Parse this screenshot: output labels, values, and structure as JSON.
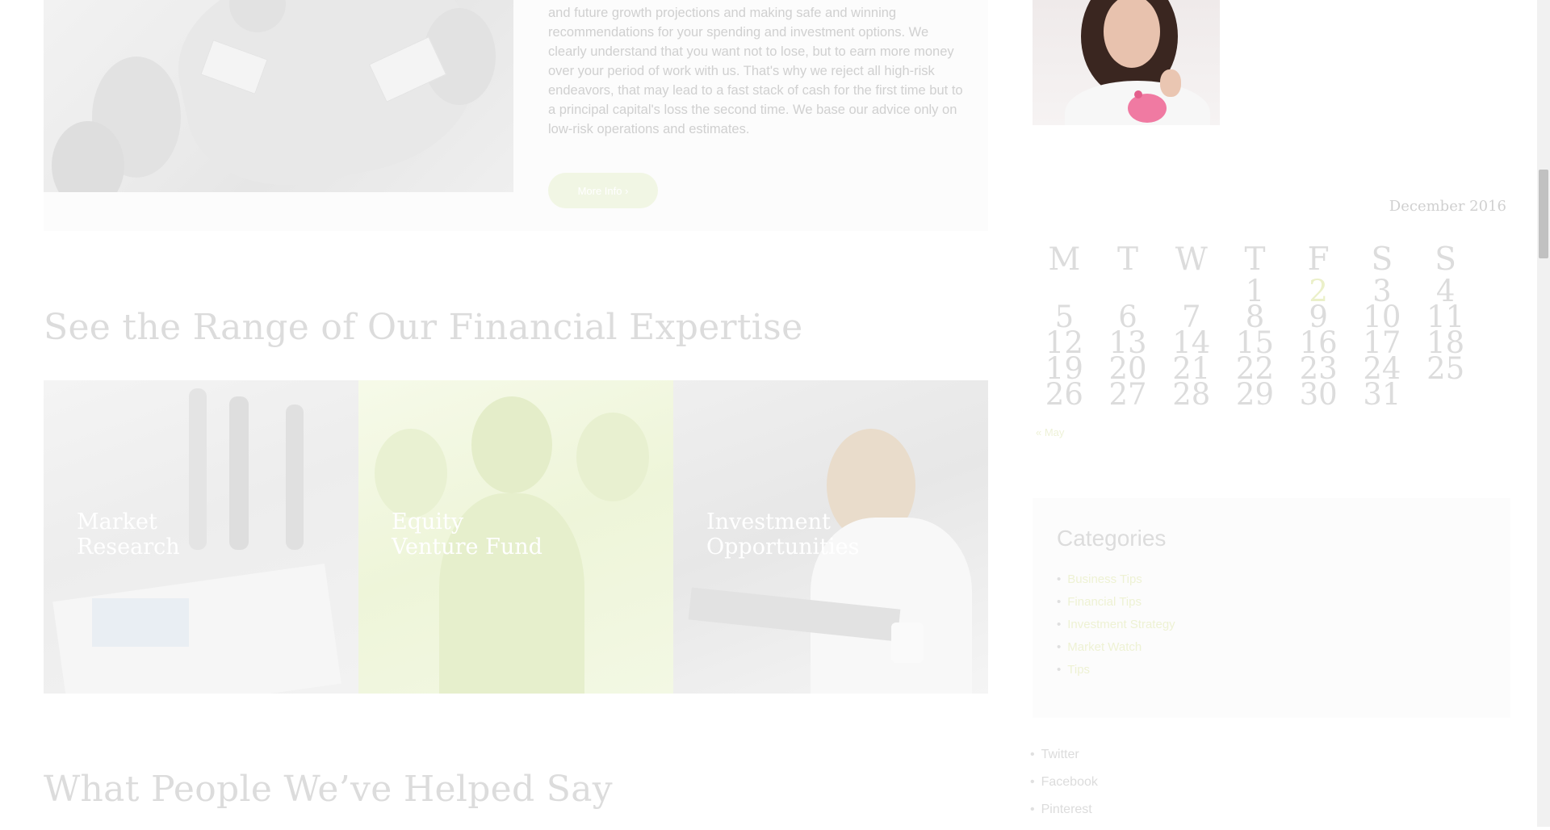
{
  "about": {
    "text": "and future growth projections and making safe and winning recommendations for your spending and investment options. We clearly understand that you want not to lose, but to earn more money over your period of work with us. That's why we reject all high-risk endeavors, that may lead to a fast stack of cash for the first time but to a principal capital's loss the second time. We base our advice only on low-risk operations and estimates.",
    "button_label": "More Info  ›"
  },
  "expertise": {
    "title": "See the Range of Our Financial Expertise",
    "services": [
      {
        "line1": "Market",
        "line2": "Research"
      },
      {
        "line1": "Equity",
        "line2": "Venture Fund"
      },
      {
        "line1": "Investment",
        "line2": "Opportunities"
      }
    ]
  },
  "testimonials": {
    "title": "What People We’ve Helped Say"
  },
  "calendar": {
    "caption": "December 2016",
    "weekdays": [
      "M",
      "T",
      "W",
      "T",
      "F",
      "S",
      "S"
    ],
    "weeks": [
      [
        "",
        "",
        "",
        "1",
        "2",
        "3",
        "4"
      ],
      [
        "5",
        "6",
        "7",
        "8",
        "9",
        "10",
        "11"
      ],
      [
        "12",
        "13",
        "14",
        "15",
        "16",
        "17",
        "18"
      ],
      [
        "19",
        "20",
        "21",
        "22",
        "23",
        "24",
        "25"
      ],
      [
        "26",
        "27",
        "28",
        "29",
        "30",
        "31",
        ""
      ]
    ],
    "today": "2",
    "prev_link": "« May"
  },
  "categories": {
    "title": "Categories",
    "items": [
      "Business Tips",
      "Financial Tips",
      "Investment Strategy",
      "Market Watch",
      "Tips"
    ]
  },
  "social": {
    "items": [
      "Twitter",
      "Facebook",
      "Pinterest"
    ]
  },
  "colors": {
    "accent": "#eef2d4",
    "today_highlight": "#ebf0c9",
    "service_green": "#eef5d9"
  }
}
